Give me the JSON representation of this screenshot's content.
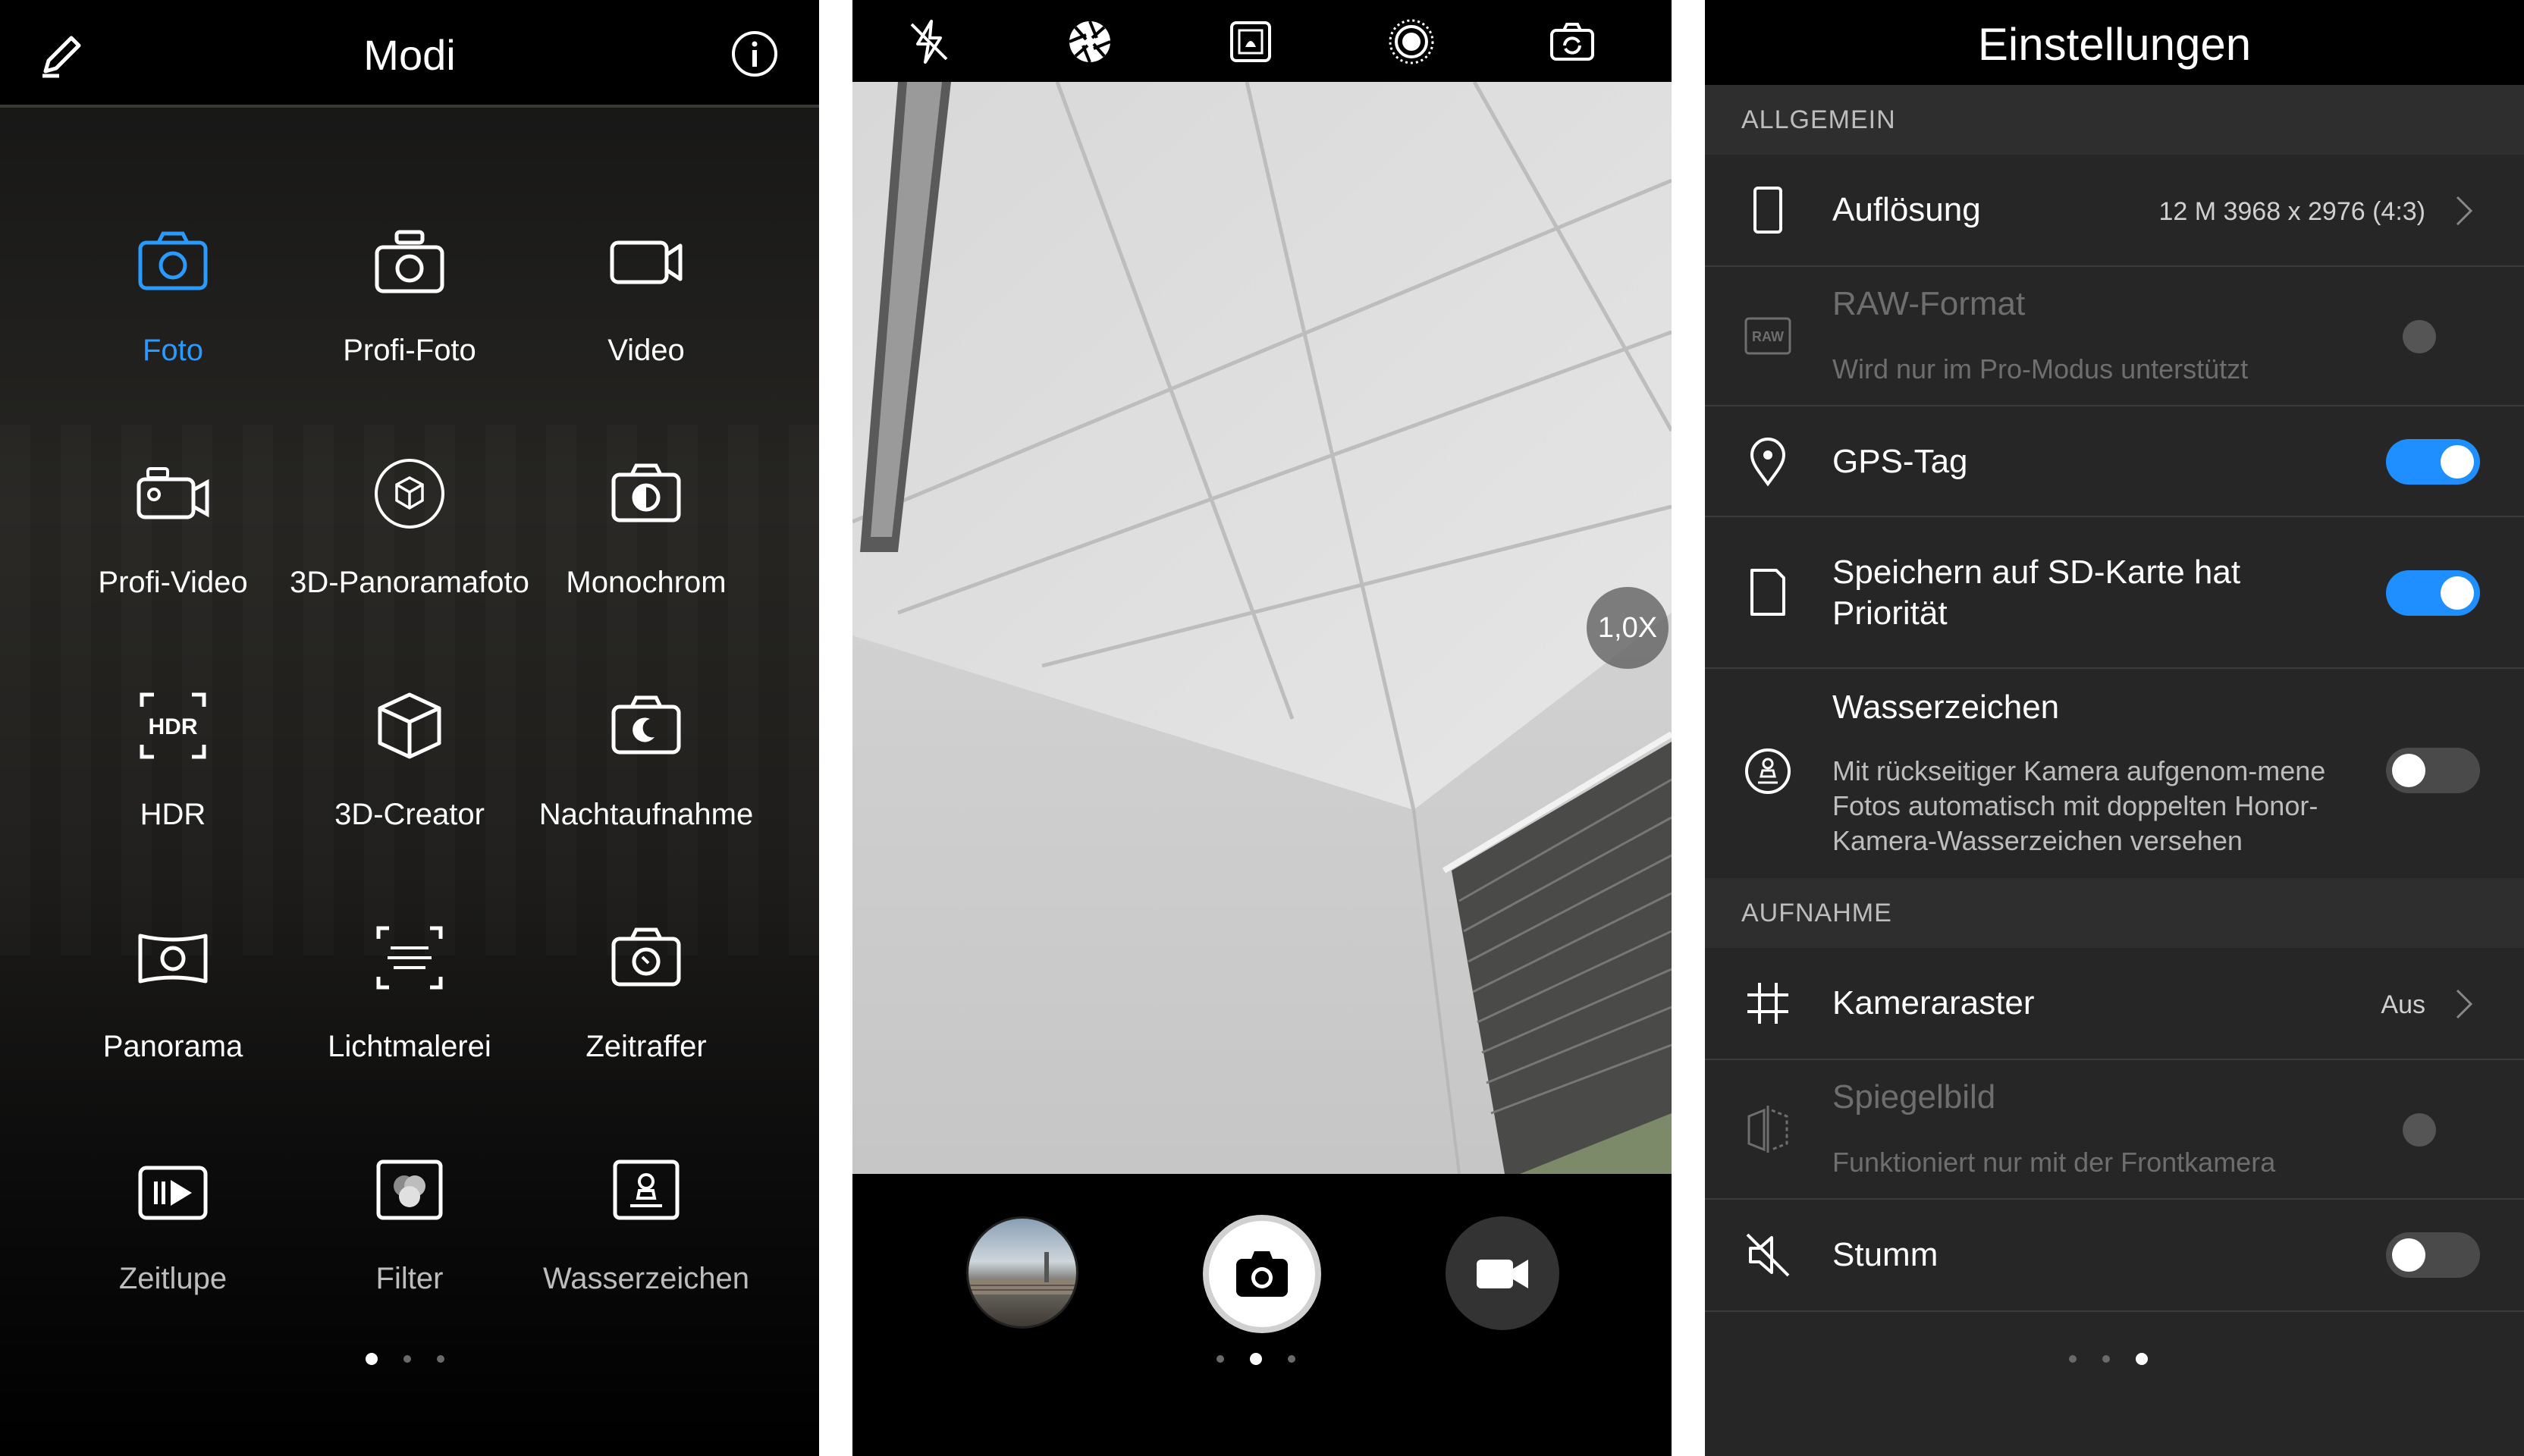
{
  "modes_screen": {
    "title": "Modi",
    "items": [
      {
        "label": "Foto",
        "icon": "camera-icon"
      },
      {
        "label": "Profi-Foto",
        "icon": "pro-camera-icon"
      },
      {
        "label": "Video",
        "icon": "video-icon"
      },
      {
        "label": "Profi-Video",
        "icon": "pro-video-icon"
      },
      {
        "label": "3D-Panoramafoto",
        "icon": "3d-panorama-icon"
      },
      {
        "label": "Monochrom",
        "icon": "monochrome-icon"
      },
      {
        "label": "HDR",
        "icon": "hdr-icon"
      },
      {
        "label": "3D-Creator",
        "icon": "cube-icon"
      },
      {
        "label": "Nachtaufnahme",
        "icon": "night-icon"
      },
      {
        "label": "Panorama",
        "icon": "panorama-icon"
      },
      {
        "label": "Lichtmalerei",
        "icon": "light-painting-icon"
      },
      {
        "label": "Zeitraffer",
        "icon": "timelapse-icon"
      },
      {
        "label": "Zeitlupe",
        "icon": "slow-motion-icon"
      },
      {
        "label": "Filter",
        "icon": "filter-icon"
      },
      {
        "label": "Wasserzeichen",
        "icon": "watermark-icon"
      }
    ],
    "active_item": "Foto",
    "accent_color": "#2b9aff"
  },
  "camera_screen": {
    "top_icons": [
      "flash-off-icon",
      "aperture-icon",
      "beauty-mode-icon",
      "live-photo-icon",
      "switch-camera-icon"
    ],
    "zoom": "1,0X"
  },
  "settings_screen": {
    "title": "Einstellungen",
    "sections": {
      "general": "ALLGEMEIN",
      "capture": "AUFNAHME"
    },
    "rows": {
      "resolution": {
        "title": "Auflösung",
        "value": "12 M 3968 x 2976 (4:3)"
      },
      "raw": {
        "title": "RAW-Format",
        "subtitle": "Wird nur im Pro-Modus unterstützt"
      },
      "gps": {
        "title": "GPS-Tag",
        "on": true
      },
      "sd": {
        "title": "Speichern auf SD-Karte hat Priorität",
        "on": true
      },
      "watermark": {
        "title": "Wasserzeichen",
        "subtitle": "Mit rückseitiger Kamera aufgenom-mene Fotos automatisch mit doppelten Honor-Kamera-Wasserzeichen versehen",
        "on": false
      },
      "grid": {
        "title": "Kameraraster",
        "value": "Aus"
      },
      "mirror": {
        "title": "Spiegelbild",
        "subtitle": "Funktioniert nur mit der Frontkamera"
      },
      "mute": {
        "title": "Stumm",
        "on": false
      }
    },
    "toggle_color": "#1f8fff"
  }
}
